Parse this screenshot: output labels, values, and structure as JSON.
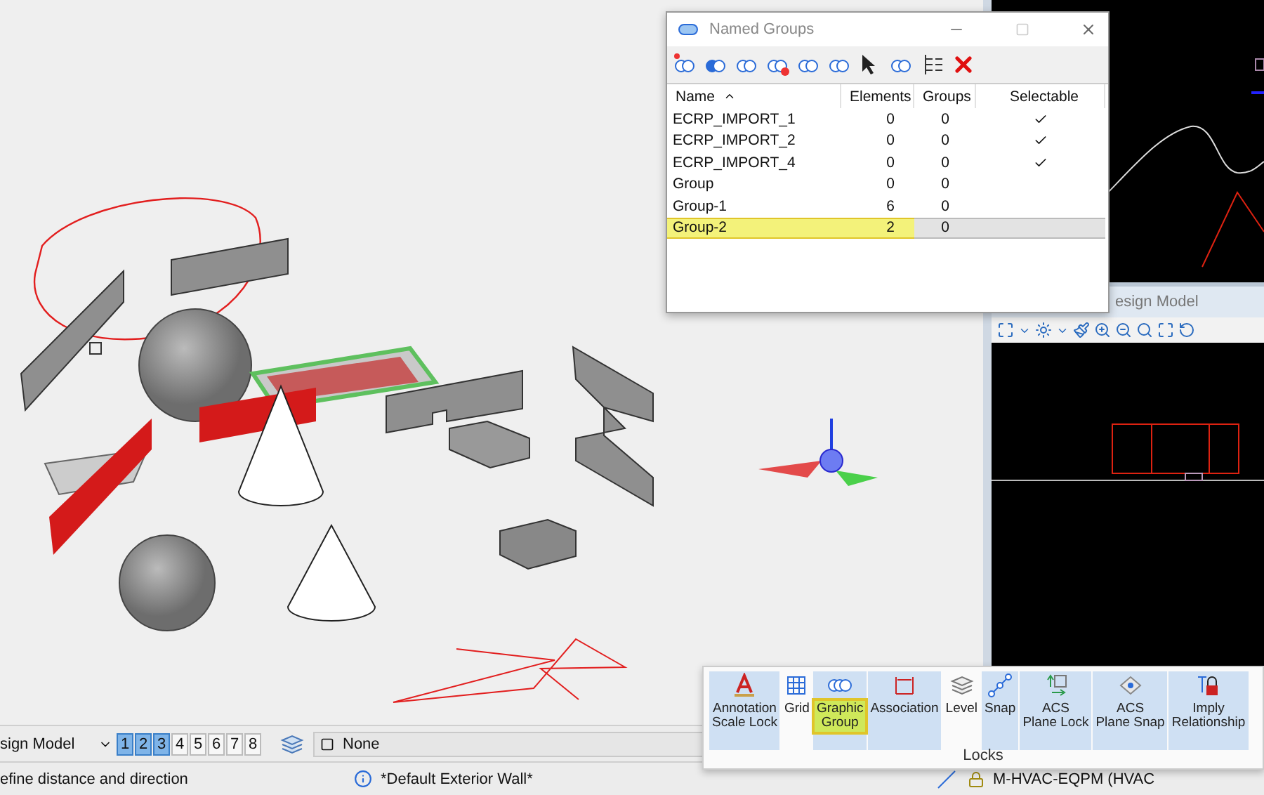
{
  "side_views": {
    "title": "esign Model"
  },
  "named_groups": {
    "title": "Named Groups",
    "columns": [
      {
        "label": "Name",
        "sorted": true
      },
      {
        "label": "Elements",
        "sorted": false
      },
      {
        "label": "Groups",
        "sorted": false
      },
      {
        "label": "Selectable",
        "sorted": false
      }
    ],
    "rows": [
      {
        "name": "ECRP_IMPORT_1",
        "elements": "0",
        "groups": "0",
        "selectable": true,
        "selected": false
      },
      {
        "name": "ECRP_IMPORT_2",
        "elements": "0",
        "groups": "0",
        "selectable": true,
        "selected": false
      },
      {
        "name": "ECRP_IMPORT_4",
        "elements": "0",
        "groups": "0",
        "selectable": true,
        "selected": false
      },
      {
        "name": "Group",
        "elements": "0",
        "groups": "0",
        "selectable": false,
        "selected": false
      },
      {
        "name": "Group-1",
        "elements": "6",
        "groups": "0",
        "selectable": false,
        "selected": false
      },
      {
        "name": "Group-2",
        "elements": "2",
        "groups": "0",
        "selectable": false,
        "selected": true
      }
    ]
  },
  "view_bar": {
    "model": "sign Model",
    "views": [
      {
        "label": "1",
        "selected": true
      },
      {
        "label": "2",
        "selected": true
      },
      {
        "label": "3",
        "selected": true
      },
      {
        "label": "4",
        "selected": false
      },
      {
        "label": "5",
        "selected": false
      },
      {
        "label": "6",
        "selected": false
      },
      {
        "label": "7",
        "selected": false
      },
      {
        "label": "8",
        "selected": false
      }
    ],
    "level": "None"
  },
  "status_bar": {
    "prompt": "efine distance and direction",
    "element_template": "*Default Exterior Wall*",
    "active_level": "M-HVAC-EQPM (HVAC"
  },
  "locks": {
    "title": "Locks",
    "items": [
      {
        "kind": "annotation",
        "label": "Annotation\nScale Lock",
        "on": true,
        "highlighted": false
      },
      {
        "kind": "grid",
        "label": "Grid",
        "on": false,
        "highlighted": false
      },
      {
        "kind": "group",
        "label": "Graphic\nGroup",
        "on": true,
        "highlighted": true
      },
      {
        "kind": "association",
        "label": "Association",
        "on": true,
        "highlighted": false
      },
      {
        "kind": "level",
        "label": "Level",
        "on": false,
        "highlighted": false
      },
      {
        "kind": "snap",
        "label": "Snap",
        "on": true,
        "highlighted": false
      },
      {
        "kind": "acslock",
        "label": "ACS\nPlane Lock",
        "on": true,
        "highlighted": false
      },
      {
        "kind": "acssnap",
        "label": "ACS\nPlane Snap",
        "on": true,
        "highlighted": false
      },
      {
        "kind": "imply",
        "label": "Imply\nRelationship",
        "on": true,
        "highlighted": false
      }
    ]
  }
}
